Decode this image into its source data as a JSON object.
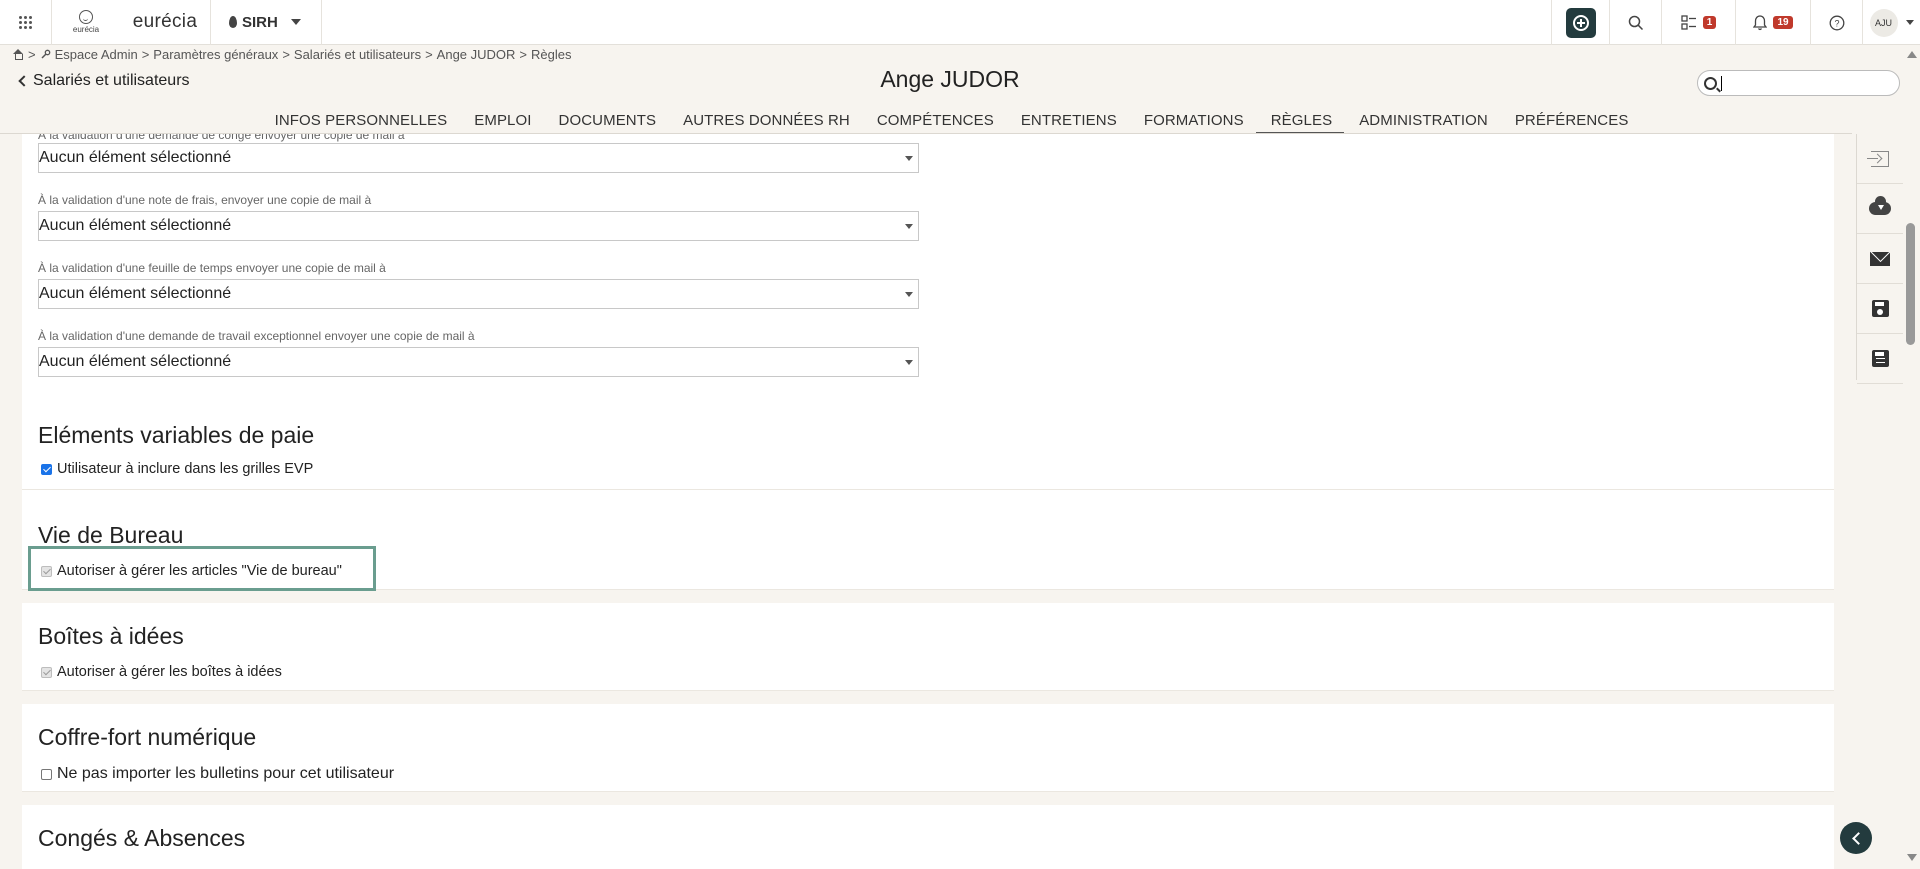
{
  "topbar": {
    "logo_small_text": "eurécia",
    "brand": "eurécia",
    "module": "SIRH",
    "tasks_badge": "1",
    "notif_badge": "19",
    "user_initials": "AJU"
  },
  "breadcrumb": {
    "separator": ">",
    "items": [
      "Espace Admin",
      "Paramètres généraux",
      "Salariés et utilisateurs",
      "Ange JUDOR",
      "Règles"
    ]
  },
  "header": {
    "back_label": "Salariés et utilisateurs",
    "title": "Ange JUDOR",
    "search_value": ""
  },
  "tabs": [
    {
      "label": "INFOS PERSONNELLES"
    },
    {
      "label": "EMPLOI"
    },
    {
      "label": "DOCUMENTS"
    },
    {
      "label": "AUTRES DONNÉES RH"
    },
    {
      "label": "COMPÉTENCES"
    },
    {
      "label": "ENTRETIENS"
    },
    {
      "label": "FORMATIONS"
    },
    {
      "label": "RÈGLES",
      "active": true
    },
    {
      "label": "ADMINISTRATION"
    },
    {
      "label": "PRÉFÉRENCES"
    }
  ],
  "mail_copies": {
    "fields": [
      {
        "label": "À la validation d'une demande de congé envoyer une copie de mail à",
        "value": "Aucun élément sélectionné"
      },
      {
        "label": "À la validation d'une note de frais, envoyer une copie de mail à",
        "value": "Aucun élément sélectionné"
      },
      {
        "label": "À la validation d'une feuille de temps envoyer une copie de mail à",
        "value": "Aucun élément sélectionné"
      },
      {
        "label": "À la validation d'une demande de travail exceptionnel envoyer une copie de mail à",
        "value": "Aucun élément sélectionné"
      }
    ]
  },
  "sections": {
    "evp": {
      "title": "Eléments variables de paie",
      "checkbox_label": "Utilisateur à inclure dans les grilles EVP",
      "checked": true
    },
    "vie_bureau": {
      "title": "Vie de Bureau",
      "checkbox_label": "Autoriser à gérer les articles \"Vie de bureau\"",
      "checked": true,
      "disabled": true
    },
    "boites_idees": {
      "title": "Boîtes à idées",
      "checkbox_label": "Autoriser à gérer les boîtes à idées",
      "checked": true,
      "disabled": true
    },
    "coffre_fort": {
      "title": "Coffre-fort numérique",
      "checkbox_label": "Ne pas importer les bulletins pour cet utilisateur",
      "checked": false
    },
    "conges": {
      "title": "Congés & Absences"
    }
  },
  "side_panel": {
    "icons": [
      "exit-icon",
      "cloud-download-icon",
      "mail-icon",
      "save-icon",
      "save-as-icon"
    ]
  },
  "colors": {
    "dark_teal": "#233b3e",
    "badge_red": "#c0392b",
    "highlight": "#6a9d8f",
    "background": "#f7f4ef"
  }
}
